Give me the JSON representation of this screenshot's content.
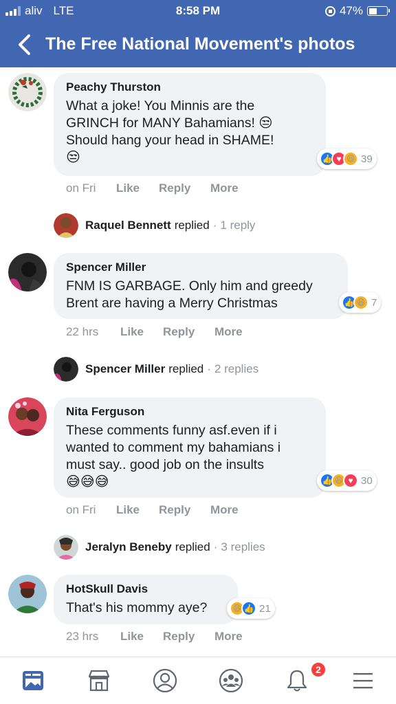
{
  "status_bar": {
    "carrier": "aliv",
    "network": "LTE",
    "time": "8:58 PM",
    "battery": "47%",
    "battery_level": 0.47
  },
  "header": {
    "title": "The Free National Movement's photos"
  },
  "actions": {
    "like": "Like",
    "reply": "Reply",
    "more": "More"
  },
  "comments": [
    {
      "author": "Peachy Thurston",
      "lines": [
        "What a joke! You Minnis are the",
        "GRINCH for MANY Bahamians! 😒",
        "Should hang your head in SHAME!"
      ],
      "emojis": "😒",
      "time": "on Fri",
      "reactions": [
        "like",
        "love",
        "haha"
      ],
      "reaction_count": "39",
      "reply": {
        "name": "Raquel Bennett",
        "verb": "replied",
        "count": "1 reply"
      }
    },
    {
      "author": "Spencer Miller",
      "lines": [
        "FNM IS GARBAGE. Only him and greedy",
        "Brent are having a Merry Christmas"
      ],
      "emojis": "",
      "time": "22 hrs",
      "reactions": [
        "like",
        "haha"
      ],
      "reaction_count": "7",
      "reply": {
        "name": "Spencer Miller",
        "verb": "replied",
        "count": "2 replies"
      }
    },
    {
      "author": "Nita Ferguson",
      "lines": [
        "These comments funny asf.even if i",
        "wanted to comment my bahamians i",
        "must say.. good job on the insults"
      ],
      "emojis": "😅😅😅",
      "time": "on Fri",
      "reactions": [
        "like",
        "haha",
        "love"
      ],
      "reaction_count": "30",
      "reply": {
        "name": "Jeralyn Beneby",
        "verb": "replied",
        "count": "3 replies"
      }
    },
    {
      "author": "HotSkull Davis",
      "lines": [
        "That's his mommy aye?"
      ],
      "emojis": "",
      "time": "23 hrs",
      "reactions": [
        "haha",
        "like"
      ],
      "reaction_count": "21"
    }
  ],
  "bottom_nav": {
    "items": [
      "news-feed",
      "marketplace",
      "profile",
      "groups",
      "notifications",
      "menu"
    ],
    "notification_badge": "2"
  },
  "colors": {
    "brand": "#4267b2",
    "bubble": "#f0f2f5",
    "meta": "#90949c",
    "like": "#1877f2",
    "love": "#f33e58",
    "haha": "#f7b125"
  }
}
